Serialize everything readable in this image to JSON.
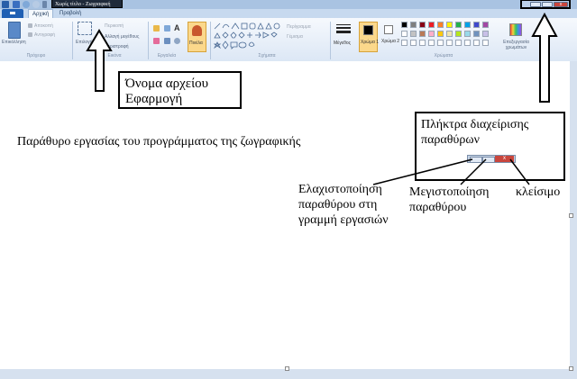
{
  "window": {
    "title": "Χωρίς τίτλο - Ζωγραφική"
  },
  "tabs": [
    {
      "label": "Αρχική"
    },
    {
      "label": "Προβολή"
    }
  ],
  "ribbon": {
    "clipboard": {
      "paste_label": "Επικόλληση",
      "cut_label": "Αποκοπή",
      "copy_label": "Αντιγραφή",
      "group_label": "Πρόχειρο"
    },
    "image": {
      "select_label": "Επιλογή",
      "crop_label": "Περικοπή",
      "resize_label": "Αλλαγή μεγέθους",
      "rotate_label": "Περιστροφή",
      "group_label": "Εικόνα"
    },
    "tools": {
      "group_label": "Εργαλεία"
    },
    "brushes": {
      "label": "Πινέλα"
    },
    "shapes": {
      "outline_label": "Περίγραμμα",
      "fill_label": "Γέμισμα",
      "group_label": "Σχήματα"
    },
    "size": {
      "label": "Μέγεθος"
    },
    "colors": {
      "color1_label": "Χρώμα 1",
      "color2_label": "Χρώμα 2",
      "edit_label": "Επεξεργασία χρωμάτων",
      "group_label": "Χρώματα",
      "palette_row1": [
        "#000000",
        "#7f7f7f",
        "#880015",
        "#ed1c24",
        "#ff7f27",
        "#fff200",
        "#22b14c",
        "#00a2e8",
        "#3f48cc",
        "#a349a4"
      ],
      "palette_row2": [
        "#ffffff",
        "#c3c3c3",
        "#b97a57",
        "#ffaec9",
        "#ffc90e",
        "#efe4b0",
        "#b5e61d",
        "#99d9ea",
        "#7092be",
        "#c8bfe7"
      ],
      "palette_row3": [
        "#ffffff",
        "#ffffff",
        "#ffffff",
        "#ffffff",
        "#ffffff",
        "#ffffff",
        "#ffffff",
        "#ffffff",
        "#ffffff",
        "#ffffff"
      ],
      "color1": "#000000",
      "color2": "#ffffff"
    }
  },
  "annotations": {
    "filename_app": [
      "Όνομα αρχείου",
      "Εφαρμογή"
    ],
    "workspace": "Παράθυρο εργασίας του προγράμματος της ζωγραφικής",
    "window_buttons": [
      "Πλήκτρα διαχείρισης",
      "παραθύρων"
    ],
    "minimize": [
      "Ελαχιστοποίηση",
      "παραθύρου στη",
      "γραμμή εργασιών"
    ],
    "maximize": [
      "Μεγιστοποίηση",
      "παραθύρου"
    ],
    "close": "κλείσιμο"
  }
}
